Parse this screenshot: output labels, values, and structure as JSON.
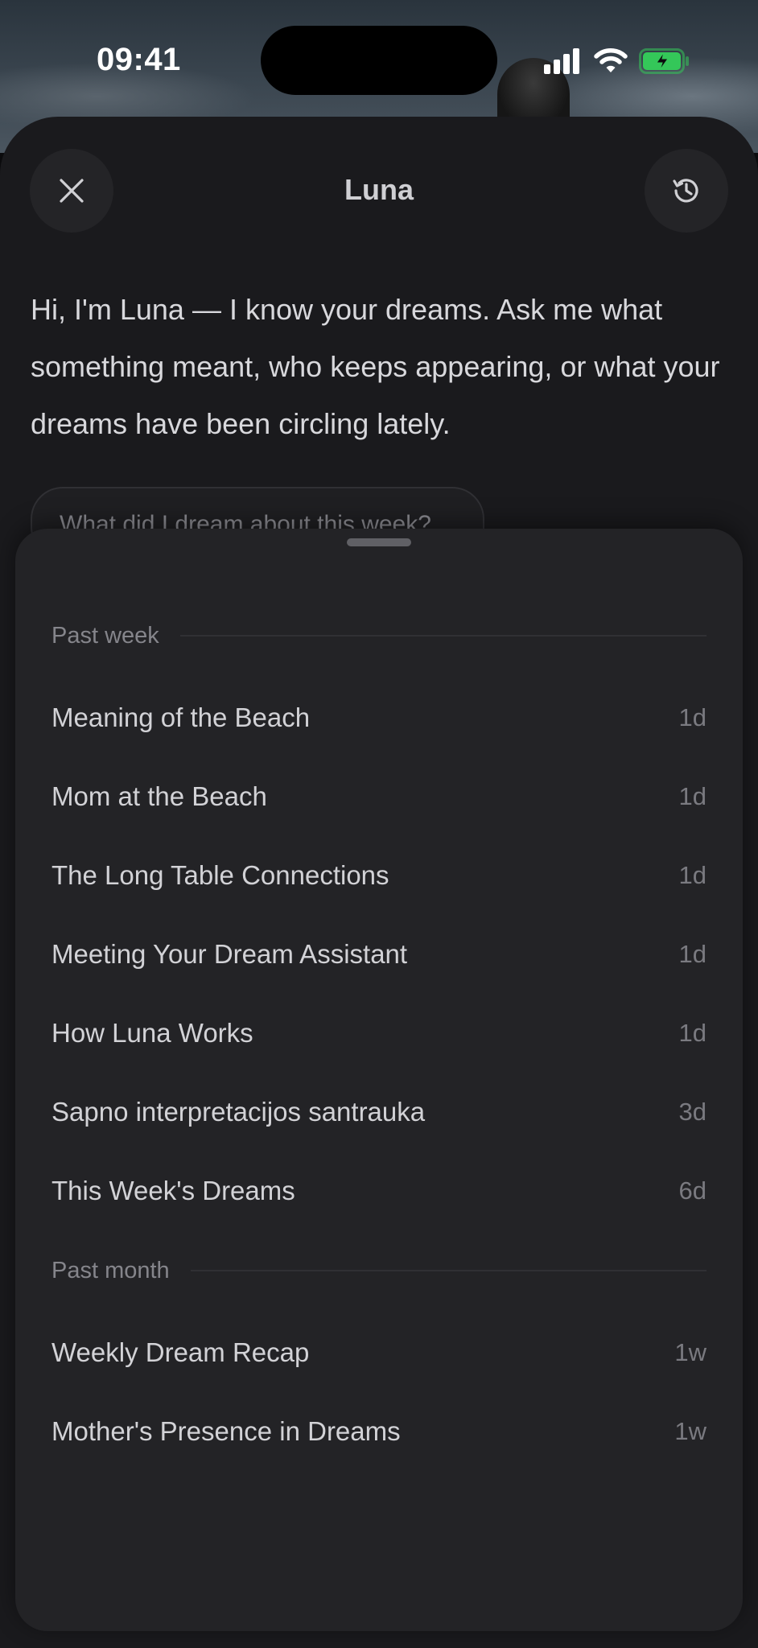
{
  "status_bar": {
    "time": "09:41"
  },
  "header": {
    "title": "Luna",
    "close_icon": "close-icon",
    "history_icon": "history-icon"
  },
  "intro": {
    "text": "Hi, I'm Luna — I know your dreams. Ask me what something meant, who keeps appearing, or what your dreams have been circling lately."
  },
  "suggestion": {
    "label": "What did I dream about this week?"
  },
  "history": {
    "sections": [
      {
        "label": "Past week",
        "items": [
          {
            "title": "Meaning of the Beach",
            "age": "1d"
          },
          {
            "title": "Mom at the Beach",
            "age": "1d"
          },
          {
            "title": "The Long Table Connections",
            "age": "1d"
          },
          {
            "title": "Meeting Your Dream Assistant",
            "age": "1d"
          },
          {
            "title": "How Luna Works",
            "age": "1d"
          },
          {
            "title": "Sapno interpretacijos santrauka",
            "age": "3d"
          },
          {
            "title": "This Week's Dreams",
            "age": "6d"
          }
        ]
      },
      {
        "label": "Past month",
        "items": [
          {
            "title": "Weekly Dream Recap",
            "age": "1w"
          },
          {
            "title": "Mother's Presence in Dreams",
            "age": "1w"
          }
        ]
      }
    ]
  },
  "colors": {
    "sheet_background": "#1a1a1d",
    "panel_background": "#232326",
    "battery_charging": "#34c759"
  }
}
